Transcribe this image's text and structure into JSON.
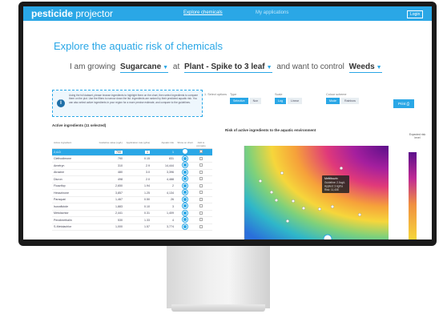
{
  "nav": {
    "logo_bold": "pesticide",
    "logo_rest": " projector",
    "active_link": "Explore chemicals",
    "other_link": "My applications",
    "login": "Login"
  },
  "page": {
    "title": "Explore the aquatic risk of chemicals",
    "sentence": {
      "prefix": "I am growing",
      "crop": "Sugarcane",
      "at": "at",
      "stage": "Plant - Spike to 3 leaf",
      "middle": "and want to control",
      "target": "Weeds"
    }
  },
  "info": {
    "text": "Using the full dataset, please browse ingredients to highlight them on the chart, then select ingredients to compare them on the plot. Use the filters to narrow down the list. Ingredients are ranked by their predicted aquatic risk. You can also select active ingredients in your region for a more precise estimate, and compare to the guidelines."
  },
  "filters": {
    "g1_label": "1. Select options",
    "g2_label": "Type",
    "g2_opts": [
      "Selective",
      "Non"
    ],
    "g3_label": "Scale",
    "g3_opts": [
      "Log",
      "Linear"
    ],
    "g4_label": "Colour scheme",
    "g4_opts": [
      "Mode",
      "Rainbow"
    ],
    "print": "Print"
  },
  "table": {
    "title": "Active ingredients (11 selected)",
    "headers": [
      "Active ingredient",
      "Guideline value (ug/L)",
      "Application rate (g/ha)",
      "Aquatic risk",
      "Show on chart",
      "Add to compare"
    ],
    "rows": [
      {
        "name": "2,4-D",
        "g": "700",
        "r": "1",
        "risk": "1"
      },
      {
        "name": "Clethodimone",
        "g": "790",
        "r": "0.15",
        "risk": "831"
      },
      {
        "name": "Ametryn",
        "g": "310",
        "r": "2.9",
        "risk": "14,444"
      },
      {
        "name": "Atrazine",
        "g": "480",
        "r": "3.0",
        "risk": "3,396"
      },
      {
        "name": "Diuron",
        "g": "498",
        "r": "2.0",
        "risk": "4,488"
      },
      {
        "name": "Fluazifop",
        "g": "2,650",
        "r": "1.94",
        "risk": "2"
      },
      {
        "name": "Hexazinone",
        "g": "3,857",
        "r": "1.25",
        "risk": "4,134"
      },
      {
        "name": "Paraquat",
        "g": "1,467",
        "r": "0.50",
        "risk": "26"
      },
      {
        "name": "Isoxaflutole",
        "g": "1,883",
        "r": "0.10",
        "risk": "3"
      },
      {
        "name": "Metolachlor",
        "g": "2,441",
        "r": "0.31",
        "risk": "1,409"
      },
      {
        "name": "Pendimethalin",
        "g": "530",
        "r": "1.33",
        "risk": "4"
      },
      {
        "name": "S-Metolachlor",
        "g": "1,000",
        "r": "1.57",
        "risk": "3,774"
      }
    ]
  },
  "plot": {
    "title": "Risk of active ingredients to the aquatic environment",
    "legend_title": "Expected risk level",
    "tooltip": [
      "Metribuzin",
      "Guideline: 2.0ug/L",
      "Applied: 3 kg/ha",
      "Risk: 11,408"
    ]
  },
  "colors": {
    "accent": "#2aa7e6",
    "plot_high": "#7b1fa2",
    "plot_low": "#1e88e5"
  }
}
